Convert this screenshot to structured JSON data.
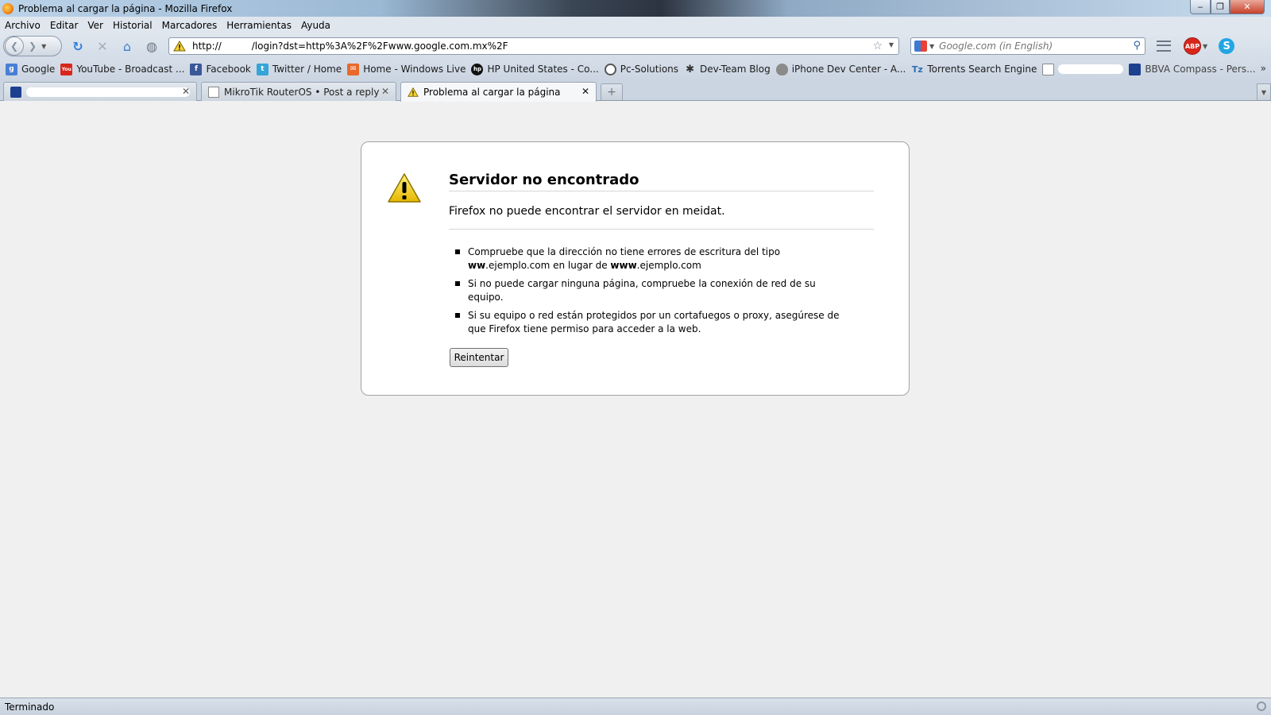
{
  "window": {
    "title": "Problema al cargar la página - Mozilla Firefox",
    "min_glyph": "‒",
    "max_glyph": "❐",
    "close_glyph": "✕"
  },
  "menu": [
    "Archivo",
    "Editar",
    "Ver",
    "Historial",
    "Marcadores",
    "Herramientas",
    "Ayuda"
  ],
  "nav": {
    "url_prefix": "http://",
    "url_suffix": "/login?dst=http%3A%2F%2Fwww.google.com.mx%2F",
    "search_placeholder": "Google.com (in English)"
  },
  "bookmarks": [
    {
      "label": "Google",
      "icon": "google-icon",
      "color": "#4a7fd6",
      "glyph": "g"
    },
    {
      "label": "YouTube - Broadcast ...",
      "icon": "youtube-icon",
      "color": "#d8261c",
      "glyph": "You"
    },
    {
      "label": "Facebook",
      "icon": "facebook-icon",
      "color": "#3b5998",
      "glyph": "f"
    },
    {
      "label": "Twitter / Home",
      "icon": "twitter-icon",
      "color": "#33a5d8",
      "glyph": "t"
    },
    {
      "label": "Home - Windows Live",
      "icon": "windows-live-icon",
      "color": "#e8692a",
      "glyph": "✉"
    },
    {
      "label": "HP United States - Co...",
      "icon": "hp-icon",
      "color": "#111111",
      "glyph": "hp"
    },
    {
      "label": "Pc-Solutions",
      "icon": "pc-solutions-icon",
      "color": "#777777",
      "glyph": "◐"
    },
    {
      "label": "Dev-Team Blog",
      "icon": "dev-team-icon",
      "color": "#555555",
      "glyph": "✱"
    },
    {
      "label": "iPhone Dev Center - A...",
      "icon": "apple-icon",
      "color": "#8a8a8a",
      "glyph": ""
    },
    {
      "label": "Torrents Search Engine",
      "icon": "torrents-icon",
      "color": "#2f6fb5",
      "glyph": "Tz"
    },
    {
      "label": "",
      "icon": "page-icon",
      "color": "#ffffff",
      "glyph": ""
    },
    {
      "label": "BBVA Compass - Pers...",
      "icon": "bbva-icon",
      "color": "#1d3f8f",
      "glyph": "▀"
    }
  ],
  "tabs": [
    {
      "label": "",
      "icon": "site-favicon-icon",
      "active": false
    },
    {
      "label": "MikroTik RouterOS • Post a reply",
      "icon": "page-icon",
      "active": false
    },
    {
      "label": "Problema al cargar la página",
      "icon": "warning-icon",
      "active": true
    }
  ],
  "error": {
    "title": "Servidor no encontrado",
    "short": "Firefox no puede encontrar el servidor en meidat.",
    "item1_part1": "Compruebe que la dirección no tiene errores de escritura del tipo",
    "item1_bold1": "ww",
    "item1_mid1": ".ejemplo.com en lugar de ",
    "item1_bold2": "www",
    "item1_end": ".ejemplo.com",
    "item2": "Si no puede cargar ninguna página, compruebe la conexión de red de su equipo.",
    "item3": "Si su equipo o red están protegidos por un cortafuegos o proxy, asegúrese de que Firefox tiene permiso para acceder a la web.",
    "retry_label": "Reintentar"
  },
  "status": {
    "text": "Terminado"
  }
}
